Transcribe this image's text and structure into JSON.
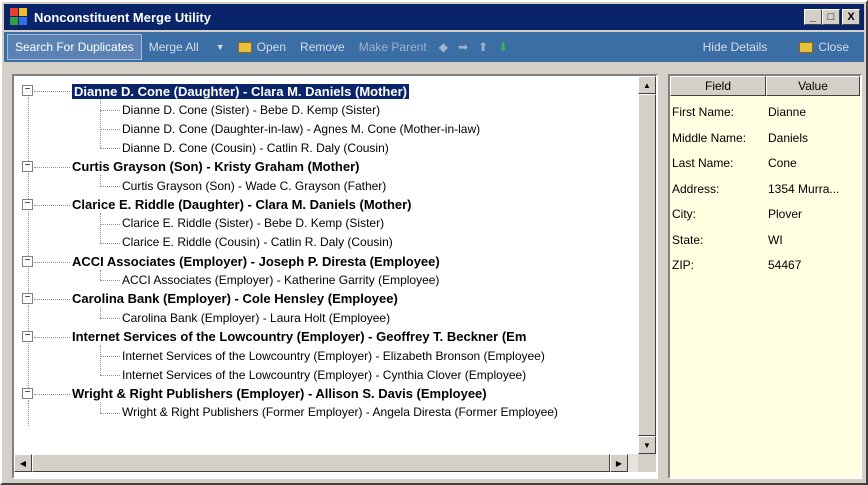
{
  "window": {
    "title": "Nonconstituent Merge Utility"
  },
  "title_buttons": {
    "minimize": "_",
    "maximize": "□",
    "close": "X"
  },
  "toolbar": {
    "search_duplicates": "Search For Duplicates",
    "merge_all": "Merge All",
    "dropdown_glyph": "▼",
    "open": "Open",
    "remove": "Remove",
    "make_parent": "Make Parent",
    "arrow_left": "◆",
    "arrow_right": "➡",
    "arrow_up": "⬆",
    "arrow_down": "⬇",
    "hide_details": "Hide Details",
    "close": "Close"
  },
  "tree": {
    "expander_glyph": "−",
    "groups": [
      {
        "parent": "Dianne D. Cone (Daughter) - Clara M. Daniels (Mother)",
        "selected": true,
        "children": [
          "Dianne D. Cone (Sister) - Bebe D. Kemp (Sister)",
          "Dianne D. Cone (Daughter-in-law) - Agnes M. Cone (Mother-in-law)",
          "Dianne D. Cone (Cousin) - Catlin R. Daly (Cousin)"
        ]
      },
      {
        "parent": "Curtis Grayson (Son) - Kristy Graham (Mother)",
        "selected": false,
        "children": [
          "Curtis Grayson (Son) - Wade C. Grayson (Father)"
        ]
      },
      {
        "parent": "Clarice E. Riddle (Daughter) - Clara M. Daniels (Mother)",
        "selected": false,
        "children": [
          "Clarice E. Riddle (Sister) - Bebe D. Kemp (Sister)",
          "Clarice E. Riddle (Cousin) - Catlin R. Daly (Cousin)"
        ]
      },
      {
        "parent": "ACCI Associates (Employer) - Joseph P. Diresta (Employee)",
        "selected": false,
        "children": [
          "ACCI Associates (Employer) - Katherine Garrity (Employee)"
        ]
      },
      {
        "parent": "Carolina Bank (Employer) - Cole Hensley (Employee)",
        "selected": false,
        "children": [
          "Carolina Bank (Employer) - Laura Holt (Employee)"
        ]
      },
      {
        "parent": "Internet Services of the Lowcountry (Employer) - Geoffrey T. Beckner (Em",
        "selected": false,
        "children": [
          "Internet Services of the Lowcountry (Employer) - Elizabeth Bronson (Employee)",
          "Internet Services of the Lowcountry (Employer) - Cynthia Clover (Employee)"
        ]
      },
      {
        "parent": "Wright & Right Publishers (Employer) - Allison S. Davis (Employee)",
        "selected": false,
        "children": [
          "Wright & Right Publishers (Former Employer) - Angela Diresta (Former Employee)"
        ]
      }
    ]
  },
  "scroll": {
    "up": "▲",
    "down": "▼",
    "left": "◀",
    "right": "▶"
  },
  "details": {
    "headers": {
      "field": "Field",
      "value": "Value"
    },
    "rows": [
      {
        "field": "First Name:",
        "value": "Dianne"
      },
      {
        "field": "Middle Name:",
        "value": "Daniels"
      },
      {
        "field": "Last Name:",
        "value": "Cone"
      },
      {
        "field": "Address:",
        "value": "1354 Murra..."
      },
      {
        "field": "City:",
        "value": "Plover"
      },
      {
        "field": "State:",
        "value": "WI"
      },
      {
        "field": "ZIP:",
        "value": "54467"
      }
    ]
  },
  "colors": {
    "titlebar": "#0a246a",
    "toolbar": "#3a6ea5",
    "selection": "#0a246a",
    "detail_background": "#ffffe1"
  }
}
